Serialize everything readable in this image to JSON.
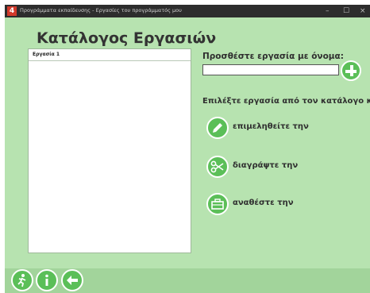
{
  "window": {
    "title": "Προγράμματα εκπαίδευσης - Εργασίες του προγράμματός μου",
    "controls": {
      "minimize": "–",
      "maximize": "☐",
      "close": "×"
    }
  },
  "heading": "Κατάλογος Εργασιών",
  "tasks": [
    {
      "label": "Εργασία 1"
    }
  ],
  "add_task": {
    "label": "Προσθέστε εργασία με όνομα:",
    "value": "",
    "placeholder": "",
    "button_icon": "plus-icon"
  },
  "select_prompt": "Επιλέξτε εργασία από τον κατάλογο και",
  "actions": [
    {
      "label": "επιμεληθείτε την",
      "icon": "pencil-icon"
    },
    {
      "label": "διαγράψτε την",
      "icon": "scissors-icon"
    },
    {
      "label": "αναθέστε την",
      "icon": "briefcase-icon"
    }
  ],
  "footer": {
    "exit_icon": "running-man-icon",
    "info_icon": "info-icon",
    "back_icon": "arrow-left-icon"
  },
  "colors": {
    "background": "#b7e3b0",
    "accent": "#5bbf58",
    "titlebar": "#2d2d2d"
  }
}
